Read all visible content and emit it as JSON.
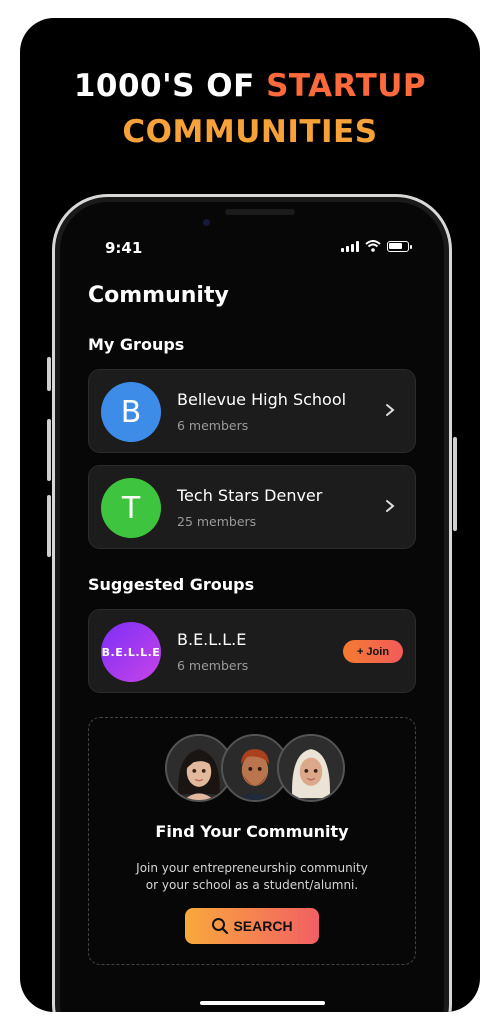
{
  "headline": {
    "line1_prefix": "1000'S OF ",
    "line1_highlight": "STARTUP",
    "line2": "COMMUNITIES"
  },
  "status_bar": {
    "time": "9:41"
  },
  "page_title": "Community",
  "my_groups": {
    "heading": "My Groups",
    "items": [
      {
        "initial": "B",
        "name": "Bellevue High School",
        "members": "6 members",
        "color": "#3d8de8"
      },
      {
        "initial": "T",
        "name": "Tech Stars Denver",
        "members": "25 members",
        "color": "#3ec43e"
      }
    ]
  },
  "suggested_groups": {
    "heading": "Suggested Groups",
    "items": [
      {
        "logo_text": "B.E.L.L.E",
        "name": "B.E.L.L.E",
        "members": "6 members",
        "join_label": "+ Join"
      }
    ]
  },
  "find_community": {
    "title": "Find Your Community",
    "description_line1": "Join your entrepreneurship community",
    "description_line2": "or your school as a student/alumni.",
    "search_label": "SEARCH"
  },
  "colors": {
    "accent_orange": "#f47b30",
    "accent_pink": "#f25b5b",
    "background": "#000000"
  }
}
